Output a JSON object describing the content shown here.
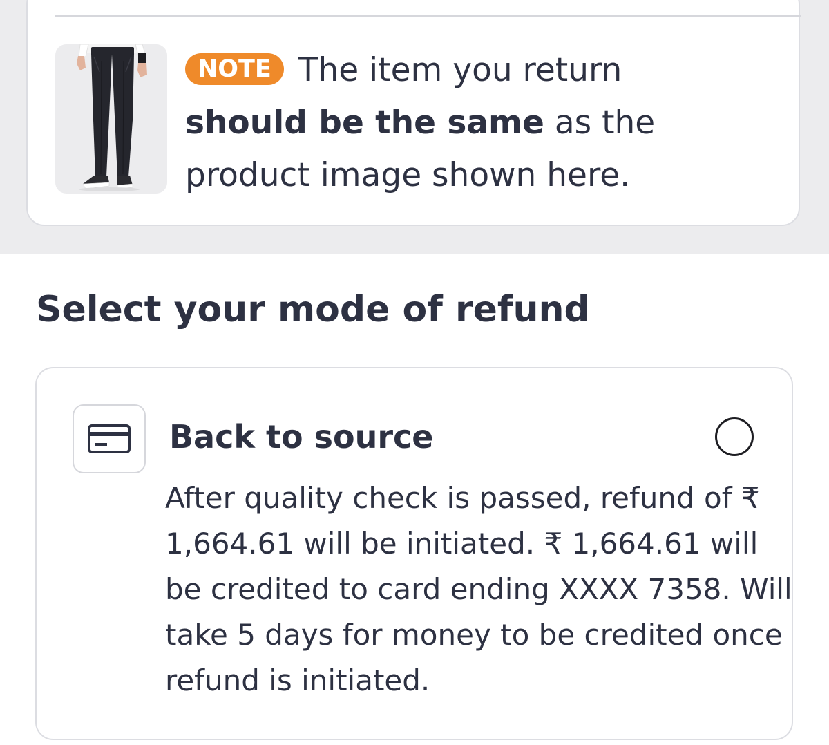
{
  "note": {
    "badge": "NOTE",
    "text_before": " The item you return ",
    "text_bold": "should be the same",
    "text_after": " as the product image shown here.",
    "thumbnail_icon": "product-trousers-image"
  },
  "refund": {
    "section_title": "Select your mode of refund",
    "option": {
      "title": "Back to source",
      "icon": "credit-card-icon",
      "selected": false,
      "description": "After quality check is passed, refund of ₹ 1,664.61 will be initiated. ₹ 1,664.61 will be credited to card ending XXXX 7358. Will take 5 days for money to be credited once refund is initiated."
    }
  },
  "colors": {
    "badge_orange": "#ef8a2a",
    "text_dark": "#2d3142",
    "band_grey": "#ececee",
    "border_grey": "#dcdde2"
  }
}
